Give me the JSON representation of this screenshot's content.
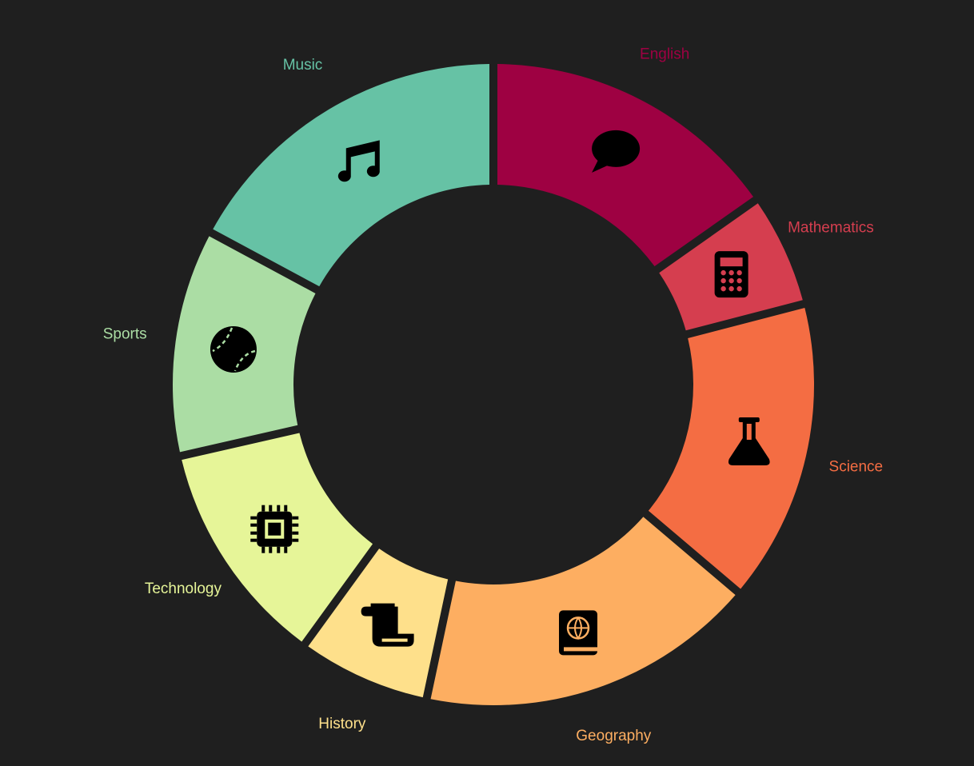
{
  "chart_data": {
    "type": "pie",
    "variant": "donut",
    "title": "",
    "background": "#1f1f1f",
    "slices": [
      {
        "label": "English",
        "value": 16,
        "color": "#9e0142",
        "icon": "speech-bubble-icon"
      },
      {
        "label": "Mathematics",
        "value": 6,
        "color": "#d53e4f",
        "icon": "calculator-icon"
      },
      {
        "label": "Science",
        "value": 16,
        "color": "#f46d43",
        "icon": "flask-icon"
      },
      {
        "label": "Geography",
        "value": 18,
        "color": "#fdae61",
        "icon": "atlas-book-icon"
      },
      {
        "label": "History",
        "value": 7,
        "color": "#fee08b",
        "icon": "scroll-icon"
      },
      {
        "label": "Technology",
        "value": 12,
        "color": "#e6f598",
        "icon": "microchip-icon"
      },
      {
        "label": "Sports",
        "value": 12,
        "color": "#abdda4",
        "icon": "baseball-icon"
      },
      {
        "label": "Music",
        "value": 18,
        "color": "#66c2a5",
        "icon": "music-note-icon"
      }
    ]
  }
}
